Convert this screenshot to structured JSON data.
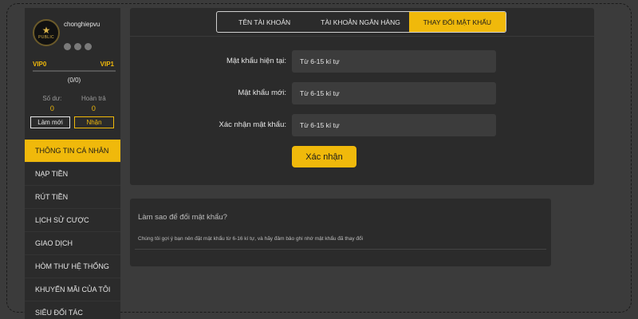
{
  "user": {
    "username": "chonghiepvu",
    "avatar_text": "PUBLIC",
    "vip_current": "VIP0",
    "vip_next": "VIP1",
    "progress_text": "(0/0)",
    "progress_fraction": 0,
    "balance_label": "Số dư:",
    "balance_value": "0",
    "rebate_label": "Hoàn trả",
    "rebate_value": "0",
    "refresh_label": "Làm mới",
    "claim_label": "Nhận"
  },
  "menu": {
    "items": [
      {
        "label": "THÔNG TIN CÁ NHÂN"
      },
      {
        "label": "NẠP TIỀN"
      },
      {
        "label": "RÚT TIỀN"
      },
      {
        "label": "LỊCH SỬ CƯỢC"
      },
      {
        "label": "GIAO DỊCH"
      },
      {
        "label": "HÒM THƯ HỆ THỐNG"
      },
      {
        "label": "KHUYẾN MÃI CỦA TÔI"
      },
      {
        "label": "SIÊU ĐỐI TÁC"
      }
    ]
  },
  "tabs": {
    "account_name": "TÊN TÀI KHOẢN",
    "bank_account": "TÀI KHOẢN NGÂN HÀNG",
    "change_password": "THAY ĐỔI MẬT KHẨU"
  },
  "form": {
    "current_label": "Mật khẩu hiện tại:",
    "current_placeholder": "Từ 6-15 kí tự",
    "new_label": "Mật khẩu mới:",
    "new_placeholder": "Từ 6-15 kí tự",
    "confirm_label": "Xác nhận mật khẩu:",
    "confirm_placeholder": "Từ 6-15 kí tự",
    "submit_label": "Xác nhận"
  },
  "help": {
    "title": "Làm sao để đổi mật khẩu?",
    "text": "Chúng tôi gợi ý bạn nên đặt mật khẩu từ 6-16 kí tự, và hãy đảm bảo ghi nhớ mật khẩu đã thay đổi"
  },
  "colors": {
    "accent": "#f0b90b",
    "panel": "#2b2b2b",
    "background": "#3b3b3b"
  }
}
